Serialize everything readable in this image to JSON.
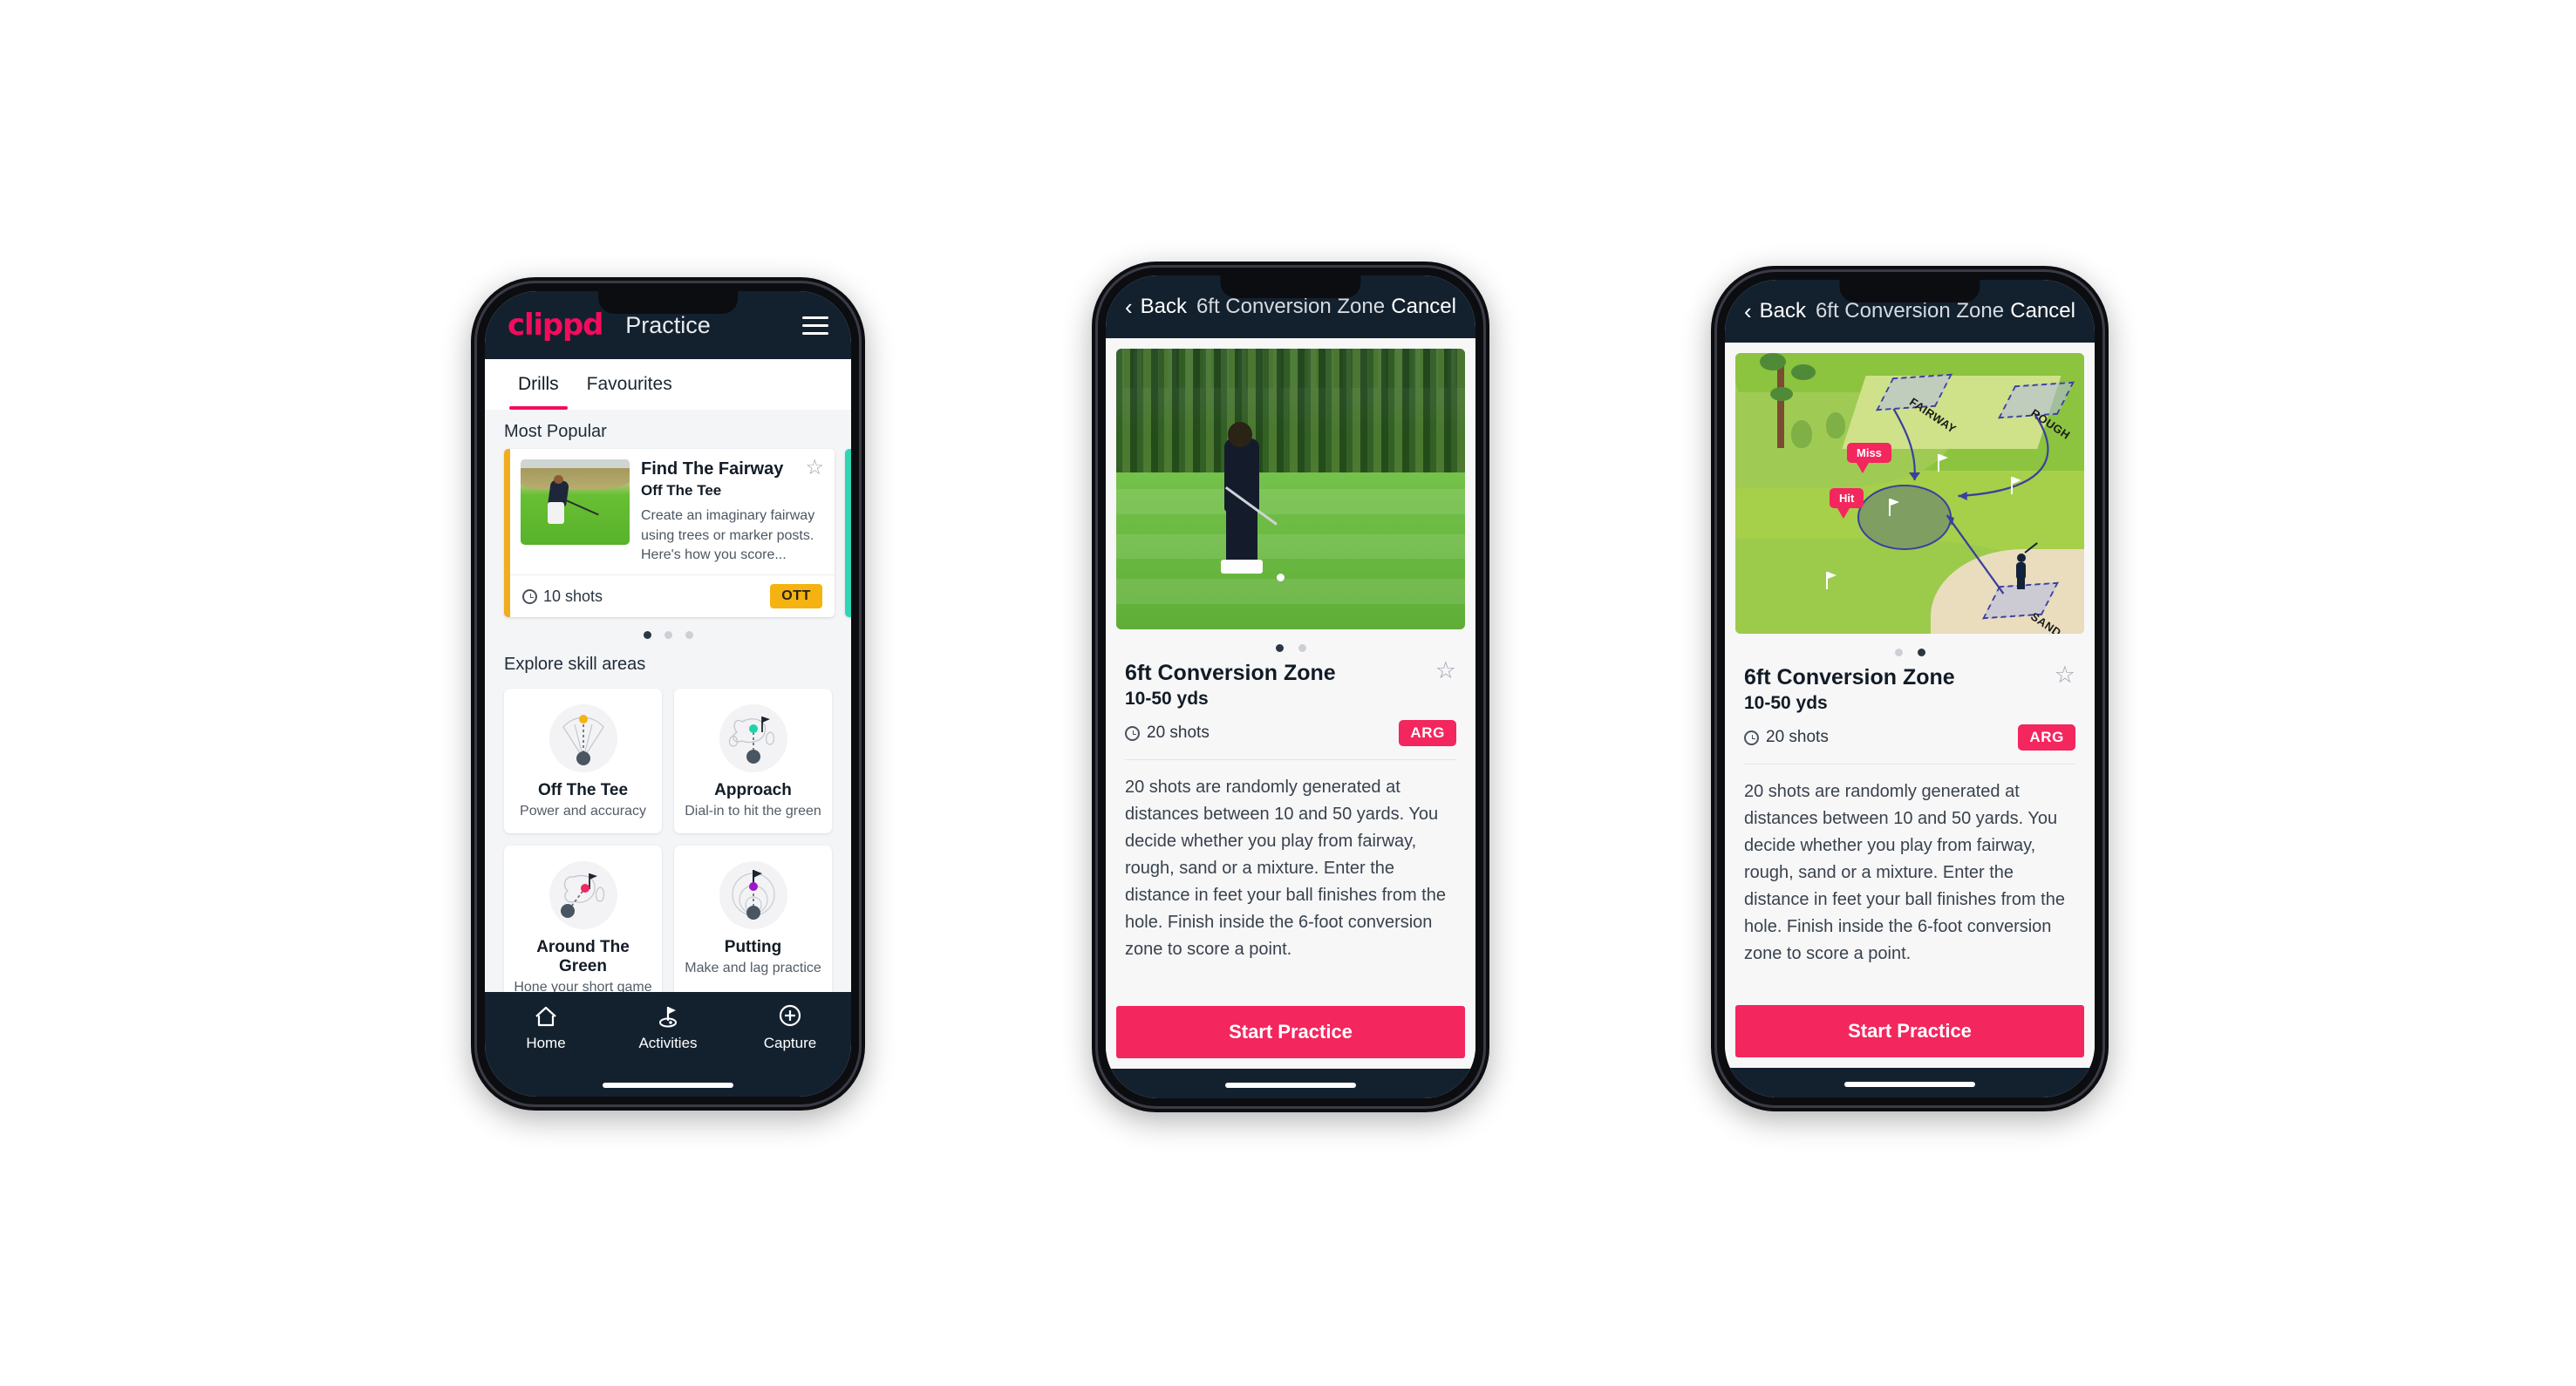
{
  "phone1": {
    "appbar": {
      "logo": "clippd",
      "title": "Practice",
      "menu_icon": "hamburger-menu-icon"
    },
    "tabs": [
      {
        "label": "Drills",
        "active": true
      },
      {
        "label": "Favourites",
        "active": false
      }
    ],
    "most_popular": {
      "heading": "Most Popular",
      "card": {
        "title": "Find The Fairway",
        "subtitle": "Off The Tee",
        "description": "Create an imaginary fairway using trees or marker posts. Here's how you score...",
        "shots": "10 shots",
        "badge": "OTT",
        "badge_color": "#f5b312",
        "accent_color": "#f0ad1d",
        "star_icon": "star-outline-icon",
        "clock_icon": "clock-icon"
      },
      "peek_accent_color": "#2fd6b4",
      "dots": [
        true,
        false,
        false
      ]
    },
    "explore": {
      "heading": "Explore skill areas",
      "cards": [
        {
          "title": "Off The Tee",
          "subtitle": "Power and accuracy",
          "icon": "tee-fan-icon",
          "dot_color": "#f5b312"
        },
        {
          "title": "Approach",
          "subtitle": "Dial-in to hit the green",
          "icon": "approach-green-icon",
          "dot_color": "#25d0a8"
        },
        {
          "title": "Around The Green",
          "subtitle": "Hone your short game",
          "icon": "around-green-icon",
          "dot_color": "#f3265e"
        },
        {
          "title": "Putting",
          "subtitle": "Make and lag practice",
          "icon": "putting-rings-icon",
          "dot_color": "#9b18c9"
        }
      ]
    },
    "tabbar": [
      {
        "label": "Home",
        "icon": "home-icon",
        "active": false
      },
      {
        "label": "Activities",
        "icon": "golf-flag-icon",
        "active": true
      },
      {
        "label": "Capture",
        "icon": "plus-circle-icon",
        "active": false
      }
    ]
  },
  "phone2": {
    "navbar": {
      "back": "Back",
      "title": "6ft Conversion Zone",
      "cancel": "Cancel",
      "back_icon": "chevron-left-icon"
    },
    "hero": {
      "media": "golf-chip-shot-photo"
    },
    "dots": [
      true,
      false
    ],
    "detail": {
      "title": "6ft Conversion Zone",
      "yards": "10-50 yds",
      "shots": "20 shots",
      "badge": "ARG",
      "badge_color": "#f3265e",
      "star_icon": "star-outline-icon",
      "clock_icon": "clock-icon",
      "description": "20 shots are randomly generated at distances between 10 and 50 yards. You decide whether you play from fairway, rough, sand or a mixture. Enter the distance in feet your ball finishes from the hole. Finish inside the 6-foot conversion zone to score a point."
    },
    "cta": "Start Practice"
  },
  "phone3": {
    "navbar": {
      "back": "Back",
      "title": "6ft Conversion Zone",
      "cancel": "Cancel",
      "back_icon": "chevron-left-icon"
    },
    "hero": {
      "media": "golf-hole-diagram",
      "zone_labels": [
        "FAIRWAY",
        "ROUGH",
        "SAND"
      ],
      "markers": [
        "Miss",
        "Hit"
      ],
      "marker_color": "#f3265e"
    },
    "dots": [
      false,
      true
    ],
    "detail": {
      "title": "6ft Conversion Zone",
      "yards": "10-50 yds",
      "shots": "20 shots",
      "badge": "ARG",
      "badge_color": "#f3265e",
      "star_icon": "star-outline-icon",
      "clock_icon": "clock-icon",
      "description": "20 shots are randomly generated at distances between 10 and 50 yards. You decide whether you play from fairway, rough, sand or a mixture. Enter the distance in feet your ball finishes from the hole. Finish inside the 6-foot conversion zone to score a point."
    },
    "cta": "Start Practice"
  }
}
